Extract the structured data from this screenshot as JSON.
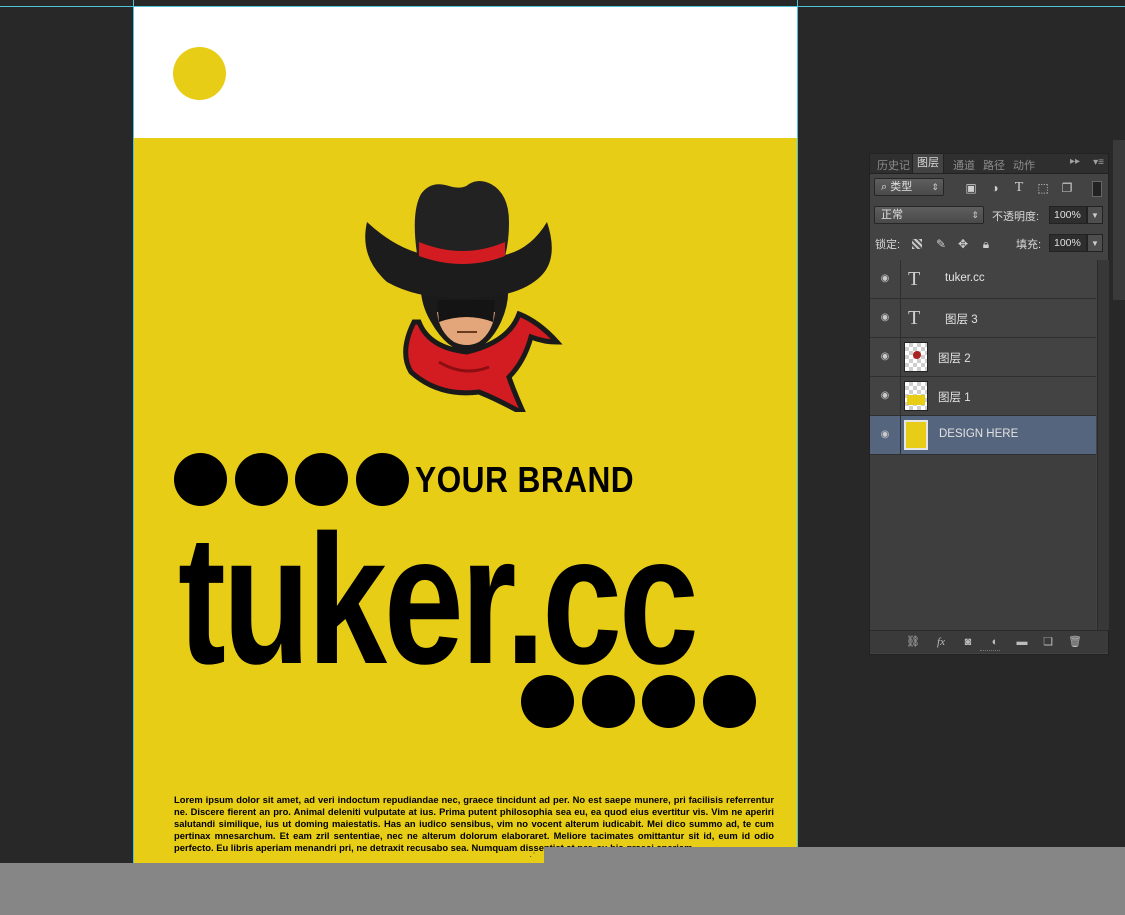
{
  "canvas": {
    "brand_tag": "YOUR BRAND",
    "title": "tuker.cc",
    "body_text": "Lorem ipsum dolor sit amet, ad veri indoctum repudiandae nec, graece tincidunt ad per. No est saepe munere, pri facilisis referrentur ne. Discere fierent an pro. Animal deleniti vulputate at ius. Prima putent philosophia sea eu, ea quod eius evertitur vis. Vim ne aperiri salutandi similique, ius ut doming maiestatis. Has an iudico sensibus, vim no vocent alterum iudicabit. Mei dico summo ad, te cum pertinax mnesarchum. Et eam zril sententiae, nec ne alterum dolorum elaboraret. Meliore tacimates omittantur sit id, eum id odio perfecto. Eu libris aperiam menandri pri, ne detraxit recusabo sea. Numquam dissentiet at per, cu his graeci aperiam.",
    "colors": {
      "yellow": "#e8cd17",
      "ink": "#000000",
      "paper": "#ffffff",
      "bandana": "#d21c22"
    }
  },
  "panel": {
    "tabs": [
      "历史记",
      "图层",
      "通道",
      "路径",
      "动作"
    ],
    "active_tab": "图层",
    "filter": {
      "label": "类型",
      "icons": [
        "image-filter-icon",
        "adjustment-filter-icon",
        "type-filter-icon",
        "shape-filter-icon",
        "smart-object-filter-icon"
      ]
    },
    "blend_mode": "正常",
    "opacity_label": "不透明度:",
    "opacity_value": "100%",
    "lock_label": "锁定:",
    "fill_label": "填充:",
    "fill_value": "100%",
    "layers": [
      {
        "name": "tuker.cc",
        "kind": "text",
        "selected": false
      },
      {
        "name": "图层 3",
        "kind": "text",
        "selected": false
      },
      {
        "name": "图层 2",
        "kind": "pixel-cowboy",
        "selected": false
      },
      {
        "name": "图层 1",
        "kind": "pixel-band",
        "selected": false
      },
      {
        "name": "DESIGN HERE",
        "kind": "pixel-yellow",
        "selected": true
      }
    ],
    "footer_icons": [
      "link-icon",
      "fx-icon",
      "mask-icon",
      "adjustment-icon",
      "folder-icon",
      "new-layer-icon",
      "trash-icon"
    ]
  }
}
